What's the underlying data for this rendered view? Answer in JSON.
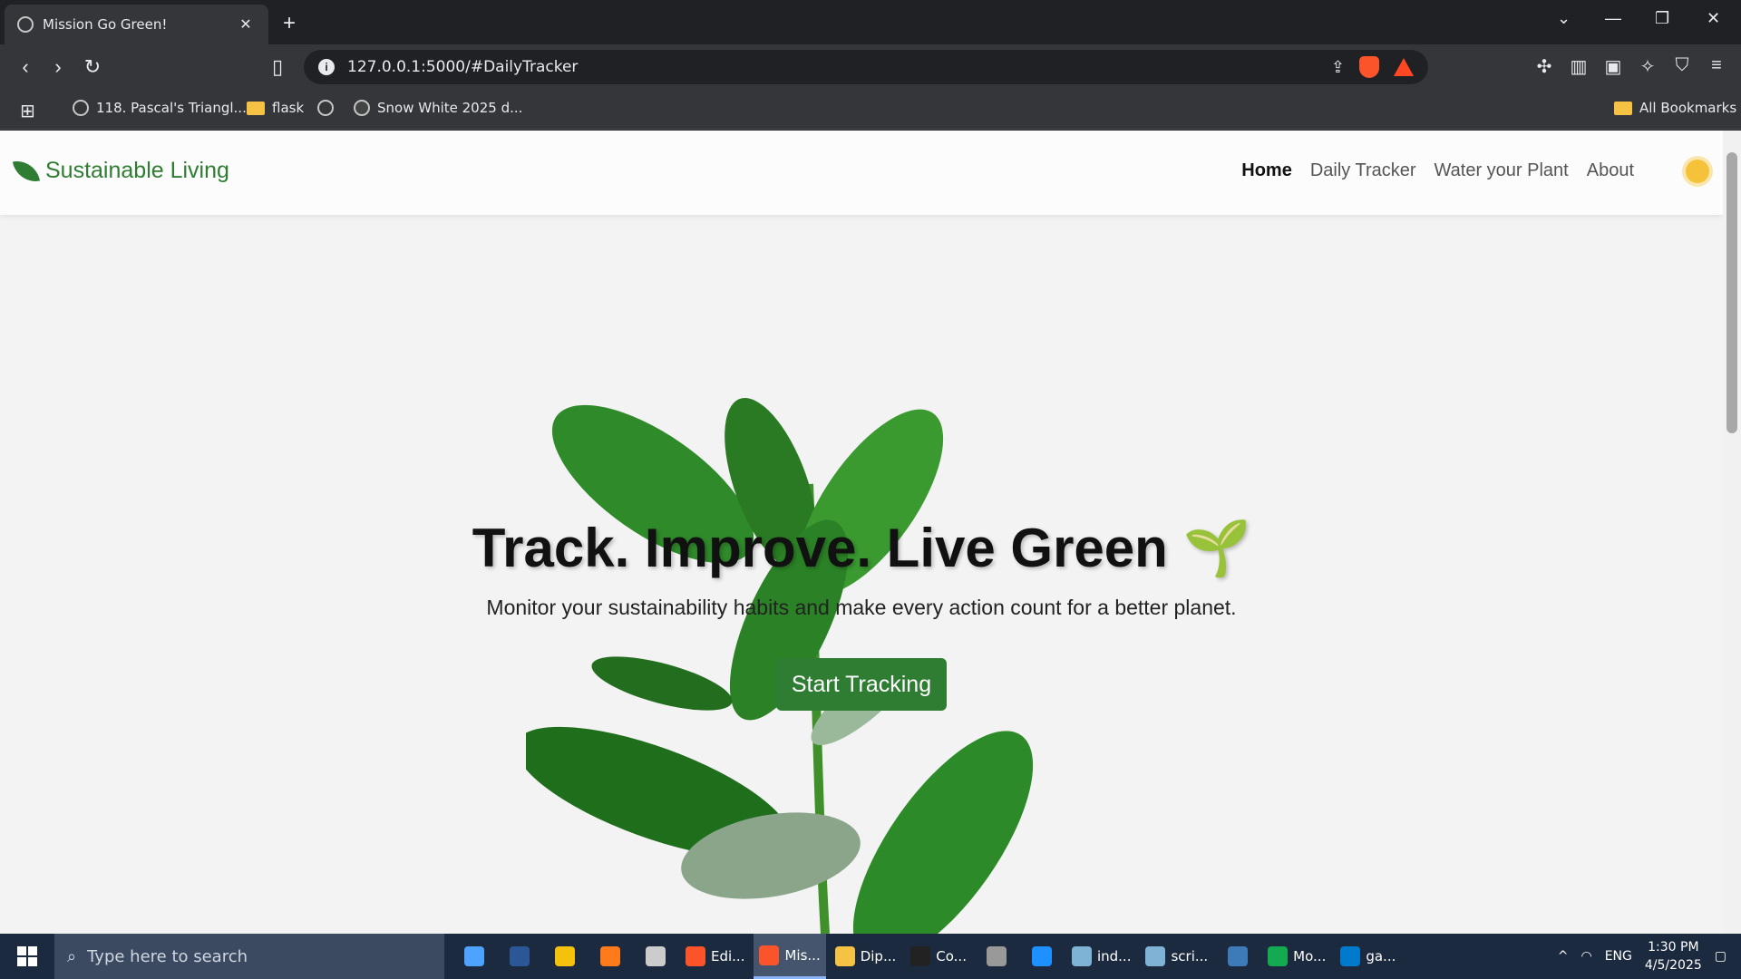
{
  "browser": {
    "tab_title": "Mission Go Green!",
    "url": "127.0.0.1:5000/#DailyTracker",
    "bookmarks": [
      {
        "label": "118. Pascal's Triangl...",
        "icon": "globe-icon"
      },
      {
        "label": "flask",
        "icon": "folder-icon"
      },
      {
        "label": "Snow White 2025 d...",
        "icon": "site-icon"
      }
    ],
    "all_bookmarks": "All Bookmarks"
  },
  "site": {
    "brand": "Sustainable Living",
    "nav": [
      "Home",
      "Daily Tracker",
      "Water your Plant",
      "About"
    ],
    "hero_title": "Track. Improve. Live Green 🌱",
    "hero_subtitle": "Monitor your sustainability habits and make every action count for a better planet.",
    "cta": "Start Tracking"
  },
  "taskbar": {
    "search_placeholder": "Type here to search",
    "items": [
      {
        "label": "",
        "color": "#4da3ff"
      },
      {
        "label": "",
        "color": "#2b5797"
      },
      {
        "label": "",
        "color": "#f4c20d"
      },
      {
        "label": "",
        "color": "#ff7a1a"
      },
      {
        "label": "",
        "color": "#cccccc"
      },
      {
        "label": "Edi...",
        "color": "#fb542b"
      },
      {
        "label": "Mis...",
        "color": "#fb542b",
        "active": true
      },
      {
        "label": "Dip...",
        "color": "#f6c244"
      },
      {
        "label": "Co...",
        "color": "#222222"
      },
      {
        "label": "",
        "color": "#999999"
      },
      {
        "label": "",
        "color": "#1e90ff"
      },
      {
        "label": "ind...",
        "color": "#7fb3d5"
      },
      {
        "label": "scri...",
        "color": "#7fb3d5"
      },
      {
        "label": "",
        "color": "#3c7ab8"
      },
      {
        "label": "Mo...",
        "color": "#13aa52"
      },
      {
        "label": "ga...",
        "color": "#007acc"
      }
    ],
    "lang": "ENG",
    "time": "1:30 PM",
    "date": "4/5/2025"
  }
}
